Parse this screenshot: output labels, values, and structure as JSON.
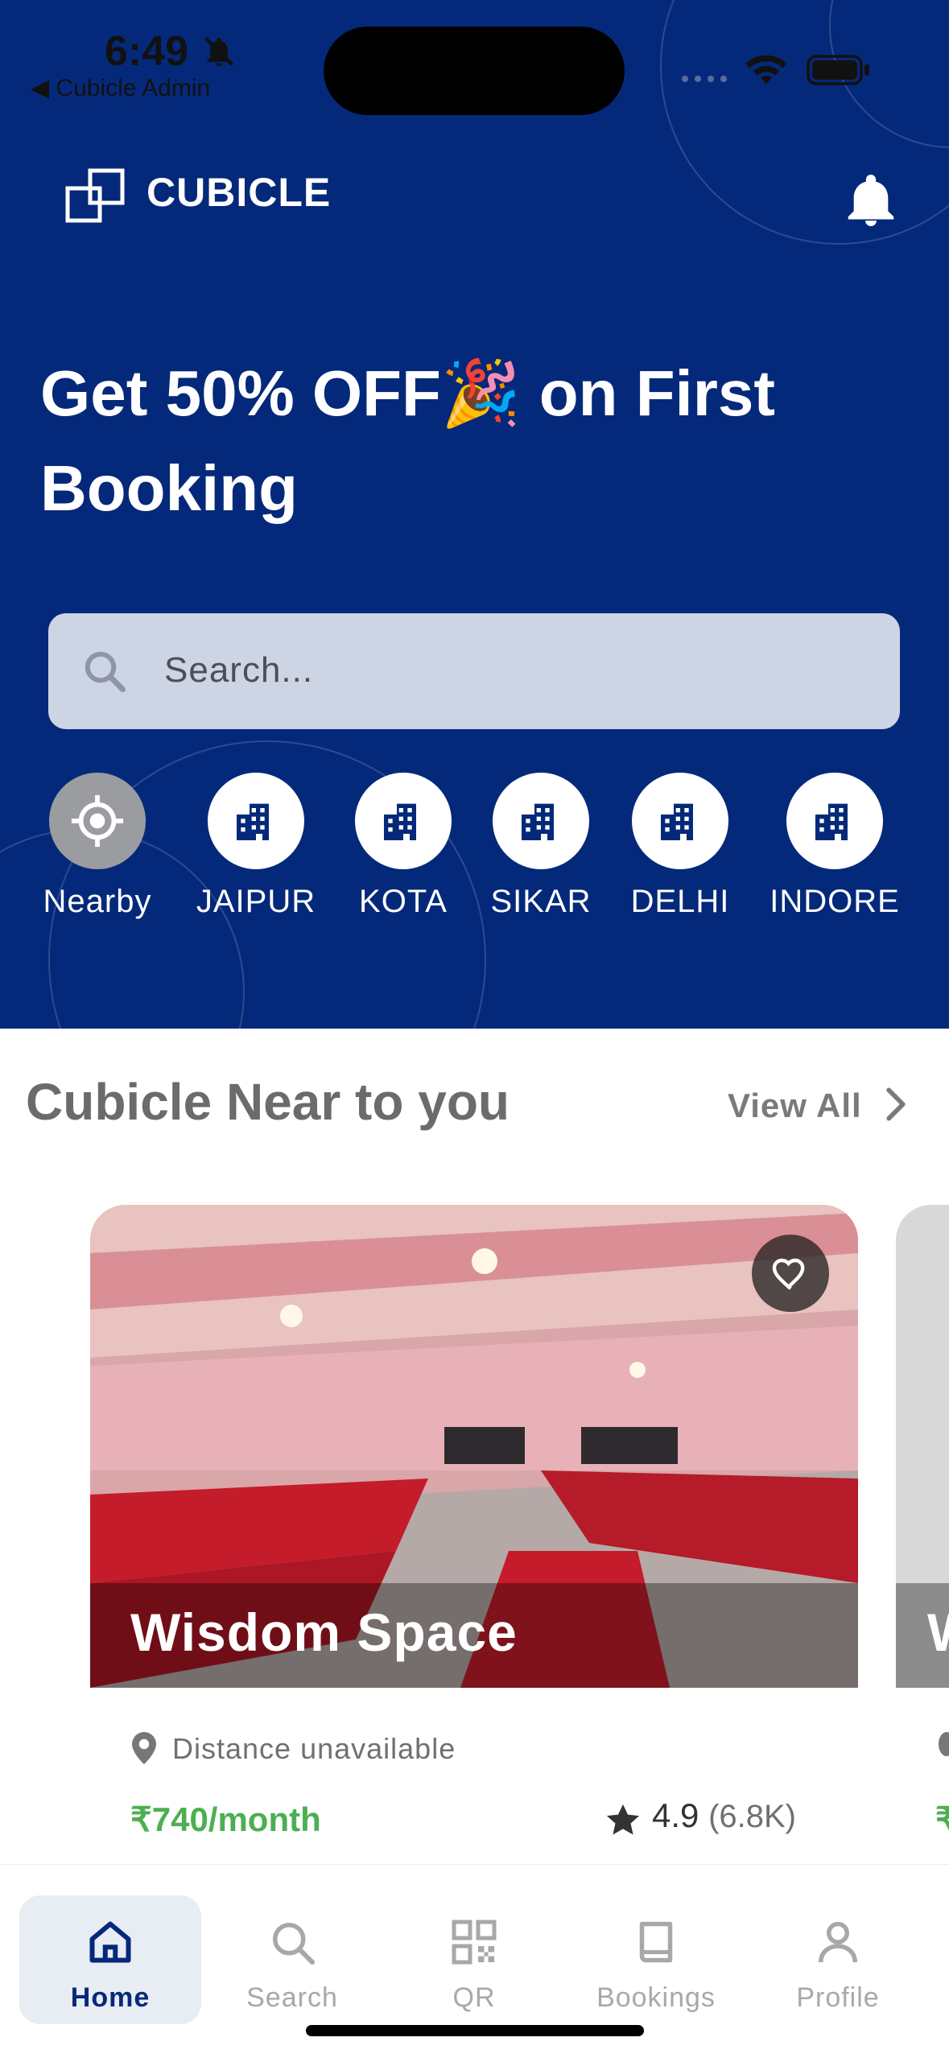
{
  "status_bar": {
    "time": "6:49",
    "back_app": "◀ Cubicle Admin"
  },
  "header": {
    "brand": "CUBICLE"
  },
  "promo": {
    "line1": "Get 50% OFF🎉 on First",
    "line2": "Booking"
  },
  "search": {
    "placeholder": "Search..."
  },
  "cities": [
    {
      "label": "Nearby",
      "icon": "location-target-icon"
    },
    {
      "label": "JAIPUR",
      "icon": "building-icon"
    },
    {
      "label": "KOTA",
      "icon": "building-icon"
    },
    {
      "label": "SIKAR",
      "icon": "building-icon"
    },
    {
      "label": "DELHI",
      "icon": "building-icon"
    },
    {
      "label": "INDORE",
      "icon": "building-icon"
    }
  ],
  "section": {
    "title": "Cubicle Near to you",
    "view_all": "View All"
  },
  "cards": [
    {
      "title": "Wisdom Space",
      "distance": "Distance unavailable",
      "price": "₹740/month",
      "rating": "4.9",
      "rating_count": "(6.8K)"
    },
    {
      "title": "W",
      "price": "₹"
    }
  ],
  "nav": [
    {
      "label": "Home",
      "icon": "home-icon",
      "active": true
    },
    {
      "label": "Search",
      "icon": "search-icon",
      "active": false
    },
    {
      "label": "QR",
      "icon": "qr-code-icon",
      "active": false
    },
    {
      "label": "Bookings",
      "icon": "book-icon",
      "active": false
    },
    {
      "label": "Profile",
      "icon": "person-icon",
      "active": false
    }
  ],
  "colors": {
    "primary": "#05297a",
    "price": "#4caf50",
    "search_bg": "#cdd4e3",
    "nav_active_bg": "#e8ecf3"
  }
}
